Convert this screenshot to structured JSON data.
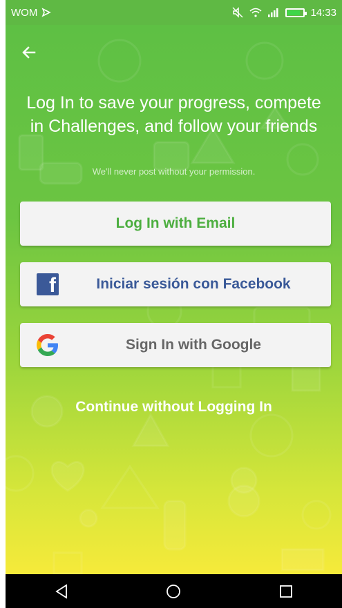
{
  "status_bar": {
    "carrier": "WOM",
    "time": "14:33",
    "icons": [
      "muted-icon",
      "wifi-icon",
      "signal-icon",
      "battery-icon"
    ]
  },
  "header": {
    "back_icon": "arrow-left-icon"
  },
  "main": {
    "headline": "Log In to save your progress, compete in Challenges, and follow your friends",
    "subtext": "We'll never post without your permission.",
    "email_button": "Log In with Email",
    "facebook_button": "Iniciar sesión con Facebook",
    "google_button": "Sign In with Google",
    "continue_link": "Continue without Logging In"
  },
  "nav_bar": {
    "icons": [
      "back-triangle-icon",
      "home-circle-icon",
      "recents-square-icon"
    ]
  },
  "colors": {
    "status_bar": "#5fb944",
    "gradient_top": "#5ec044",
    "gradient_bottom": "#f6ea3a",
    "email_text": "#4cae3f",
    "facebook_text": "#3a5998",
    "google_text": "#666666",
    "button_bg": "#f3f3f3"
  }
}
